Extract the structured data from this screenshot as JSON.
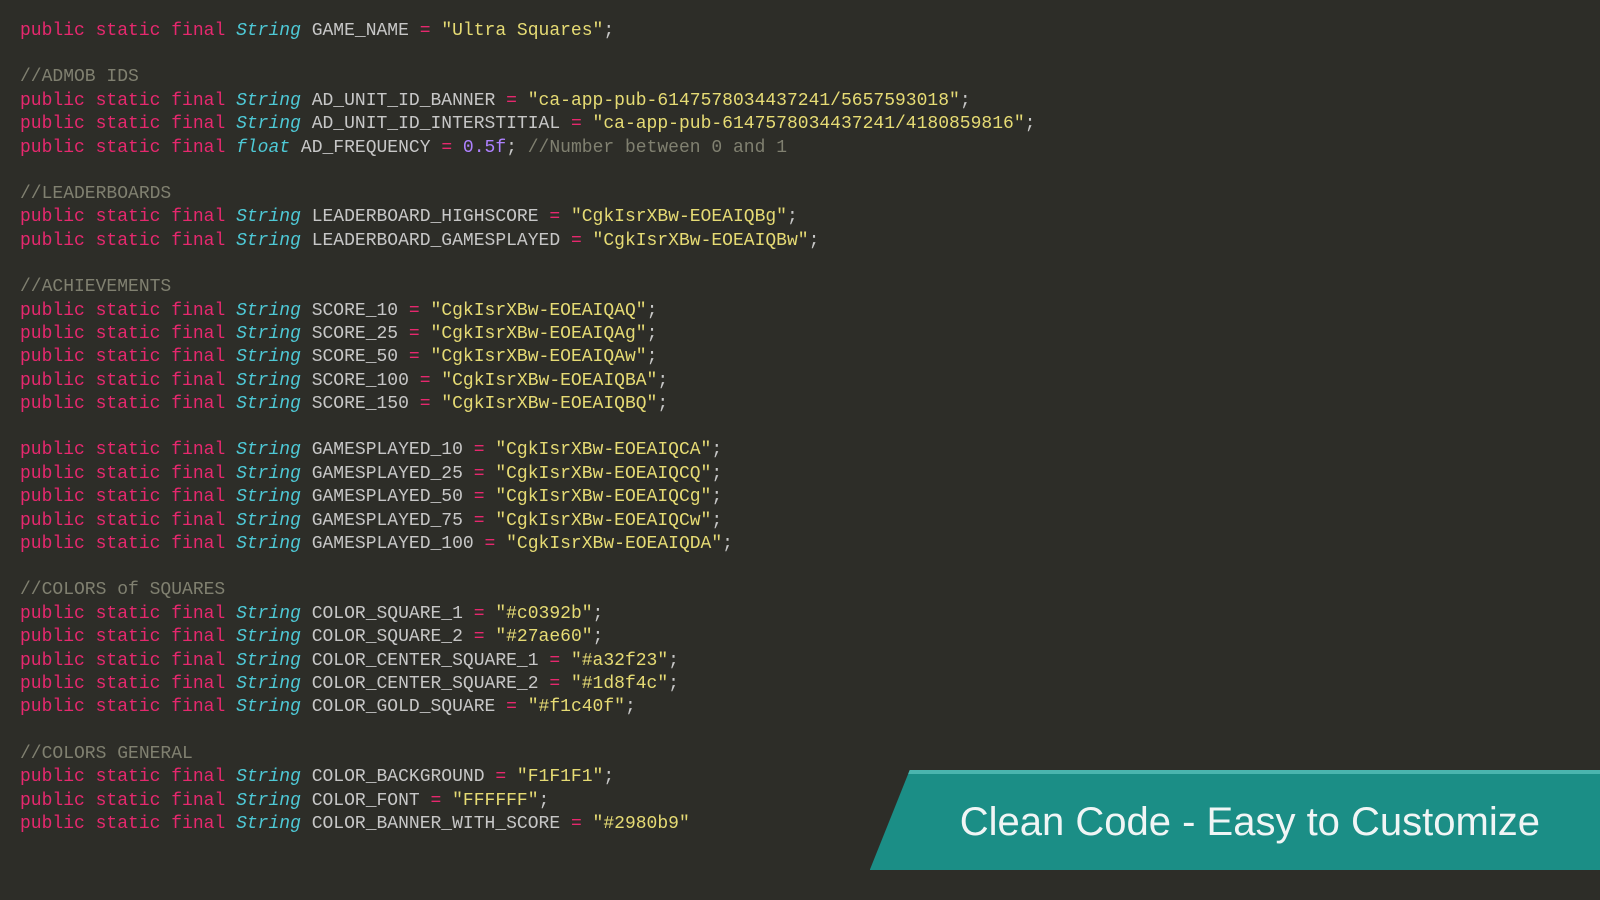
{
  "banner": {
    "text": "Clean Code - Easy to Customize"
  },
  "lines": [
    {
      "t": "decl",
      "type": "String",
      "name": "GAME_NAME",
      "value": "\"Ultra Squares\""
    },
    {
      "t": "empty"
    },
    {
      "t": "cmt",
      "text": "//ADMOB IDS"
    },
    {
      "t": "decl",
      "type": "String",
      "name": "AD_UNIT_ID_BANNER",
      "value": "\"ca-app-pub-6147578034437241/5657593018\""
    },
    {
      "t": "decl",
      "type": "String",
      "name": "AD_UNIT_ID_INTERSTITIAL",
      "value": "\"ca-app-pub-6147578034437241/4180859816\""
    },
    {
      "t": "decl",
      "type": "float",
      "name": "AD_FREQUENCY",
      "value": "0.5f",
      "vtype": "num",
      "trail": " //Number between 0 and 1"
    },
    {
      "t": "empty"
    },
    {
      "t": "cmt",
      "text": "//LEADERBOARDS"
    },
    {
      "t": "decl",
      "type": "String",
      "name": "LEADERBOARD_HIGHSCORE",
      "value": "\"CgkIsrXBw-EOEAIQBg\""
    },
    {
      "t": "decl",
      "type": "String",
      "name": "LEADERBOARD_GAMESPLAYED",
      "value": "\"CgkIsrXBw-EOEAIQBw\""
    },
    {
      "t": "empty"
    },
    {
      "t": "cmt",
      "text": "//ACHIEVEMENTS"
    },
    {
      "t": "decl",
      "type": "String",
      "name": "SCORE_10",
      "value": "\"CgkIsrXBw-EOEAIQAQ\""
    },
    {
      "t": "decl",
      "type": "String",
      "name": "SCORE_25",
      "value": "\"CgkIsrXBw-EOEAIQAg\""
    },
    {
      "t": "decl",
      "type": "String",
      "name": "SCORE_50",
      "value": "\"CgkIsrXBw-EOEAIQAw\""
    },
    {
      "t": "decl",
      "type": "String",
      "name": "SCORE_100",
      "value": "\"CgkIsrXBw-EOEAIQBA\""
    },
    {
      "t": "decl",
      "type": "String",
      "name": "SCORE_150",
      "value": "\"CgkIsrXBw-EOEAIQBQ\""
    },
    {
      "t": "empty"
    },
    {
      "t": "decl",
      "type": "String",
      "name": "GAMESPLAYED_10",
      "value": "\"CgkIsrXBw-EOEAIQCA\""
    },
    {
      "t": "decl",
      "type": "String",
      "name": "GAMESPLAYED_25",
      "value": "\"CgkIsrXBw-EOEAIQCQ\""
    },
    {
      "t": "decl",
      "type": "String",
      "name": "GAMESPLAYED_50",
      "value": "\"CgkIsrXBw-EOEAIQCg\""
    },
    {
      "t": "decl",
      "type": "String",
      "name": "GAMESPLAYED_75",
      "value": "\"CgkIsrXBw-EOEAIQCw\""
    },
    {
      "t": "decl",
      "type": "String",
      "name": "GAMESPLAYED_100",
      "value": "\"CgkIsrXBw-EOEAIQDA\""
    },
    {
      "t": "empty"
    },
    {
      "t": "cmt",
      "text": "//COLORS of SQUARES"
    },
    {
      "t": "decl",
      "type": "String",
      "name": "COLOR_SQUARE_1",
      "value": "\"#c0392b\""
    },
    {
      "t": "decl",
      "type": "String",
      "name": "COLOR_SQUARE_2",
      "value": "\"#27ae60\""
    },
    {
      "t": "decl",
      "type": "String",
      "name": "COLOR_CENTER_SQUARE_1",
      "value": "\"#a32f23\""
    },
    {
      "t": "decl",
      "type": "String",
      "name": "COLOR_CENTER_SQUARE_2",
      "value": "\"#1d8f4c\""
    },
    {
      "t": "decl",
      "type": "String",
      "name": "COLOR_GOLD_SQUARE",
      "value": "\"#f1c40f\""
    },
    {
      "t": "empty"
    },
    {
      "t": "cmt",
      "text": "//COLORS GENERAL"
    },
    {
      "t": "decl",
      "type": "String",
      "name": "COLOR_BACKGROUND",
      "value": "\"F1F1F1\""
    },
    {
      "t": "decl",
      "type": "String",
      "name": "COLOR_FONT",
      "value": "\"FFFFFF\""
    },
    {
      "t": "decl",
      "type": "String",
      "name": "COLOR_BANNER_WITH_SCORE",
      "value": "\"#2980b9\"",
      "cut": true
    }
  ]
}
